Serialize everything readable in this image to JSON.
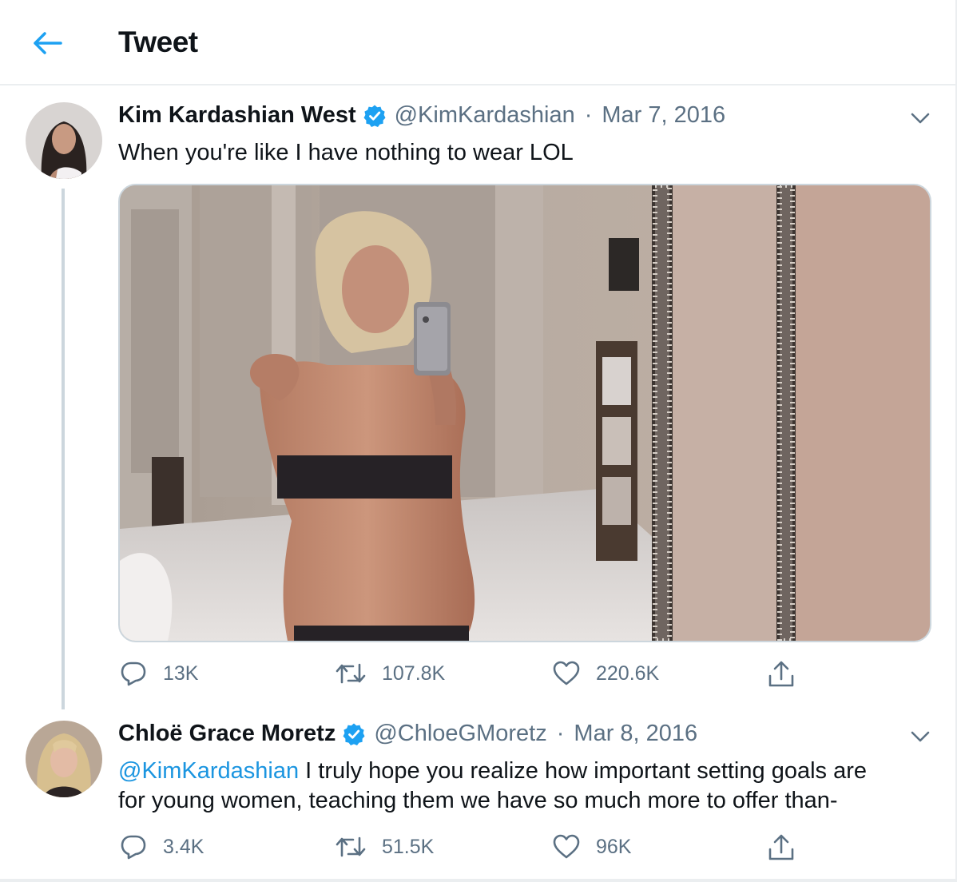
{
  "header": {
    "title": "Tweet",
    "back_icon": "arrow-left-icon"
  },
  "colors": {
    "accent": "#1da1f2",
    "mention": "#1b95e0",
    "muted": "#5b7083",
    "border": "#ebeef0"
  },
  "tweets": [
    {
      "name": "Kim Kardashian West",
      "verified": true,
      "handle": "@KimKardashian",
      "separator": "·",
      "date": "Mar 7, 2016",
      "text": "When you're like I have nothing to wear LOL",
      "has_media": true,
      "stats": {
        "replies": "13K",
        "retweets": "107.8K",
        "likes": "220.6K"
      }
    },
    {
      "name": "Chloë Grace Moretz",
      "verified": true,
      "handle": "@ChloeGMoretz",
      "separator": "·",
      "date": "Mar 8, 2016",
      "mention": "@KimKardashian",
      "text_line1": " I truly hope you realize how important setting goals are",
      "text_line2": "for young women, teaching them we have so much more to offer than-",
      "stats": {
        "replies": "3.4K",
        "retweets": "51.5K",
        "likes": "96K"
      }
    }
  ]
}
